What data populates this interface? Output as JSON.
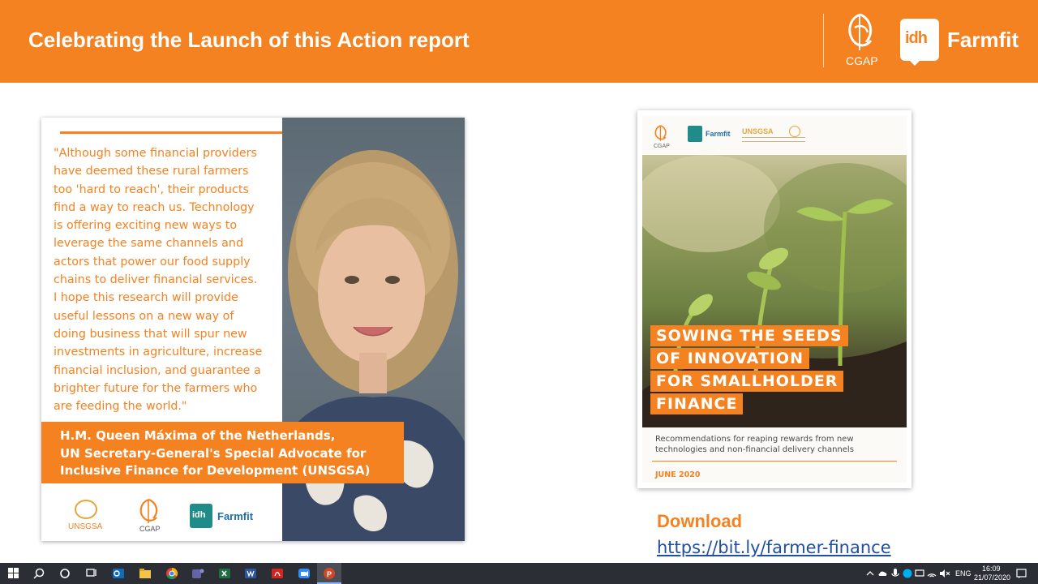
{
  "header": {
    "title": "Celebrating the Launch of this Action report",
    "logos": {
      "cgap": "CGAP",
      "idh": "idh",
      "farmfit": "Farmfit"
    }
  },
  "quote_card": {
    "quote_lines": [
      "\"Although some financial providers",
      "have deemed these rural farmers",
      "too 'hard to reach', their products",
      "find a way to reach us. Technology",
      "is offering exciting new ways to",
      "leverage the same channels and",
      "actors that power our food supply",
      "chains to deliver financial services.",
      "I hope this research will provide",
      "useful lessons on a new way of",
      "doing business that will spur new",
      "investments in agriculture, increase",
      "financial inclusion, and guarantee a",
      "brighter future for the farmers who",
      "are feeding the world.\""
    ],
    "attribution_lines": [
      "H.M. Queen Máxima of the Netherlands,",
      "UN Secretary-General's Special Advocate for",
      "Inclusive Finance for Development (UNSGSA)"
    ],
    "logos": {
      "unsgsa": "UNSGSA",
      "cgap": "CGAP",
      "idh": "idh",
      "farmfit": "Farmfit"
    }
  },
  "report": {
    "logos": {
      "cgap": "CGAP",
      "farmfit": "Farmfit",
      "unsgsa": "UNSGSA"
    },
    "title_lines": [
      "SOWING THE SEEDS",
      "OF INNOVATION",
      "FOR SMALLHOLDER",
      "FINANCE"
    ],
    "subtitle_lines": [
      "Recommendations for reaping rewards from new",
      "technologies and non-financial delivery channels"
    ],
    "date": "JUNE 2020"
  },
  "download": {
    "label": "Download",
    "link": "https://bit.ly/farmer-finance"
  },
  "taskbar": {
    "apps": [
      "windows-start",
      "search",
      "cortana",
      "task-view",
      "outlook",
      "file-explorer",
      "chrome",
      "teams",
      "excel",
      "word",
      "acrobat",
      "zoom",
      "powerpoint"
    ],
    "language": "ENG",
    "time": "16:09",
    "date": "21/07/2020"
  },
  "colors": {
    "accent_orange": "#f58220",
    "link_blue": "#1f4fa3",
    "taskbar": "#2b2f35"
  }
}
